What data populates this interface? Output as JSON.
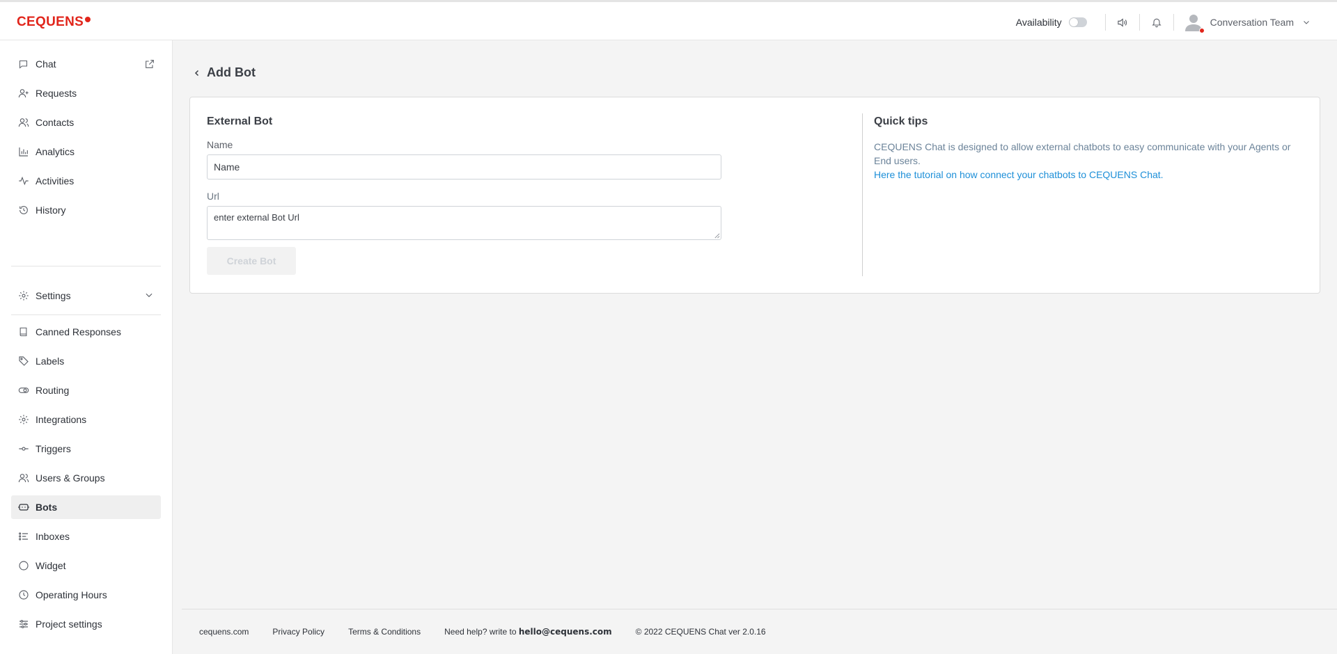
{
  "brand": {
    "logo_text": "CEQUENS",
    "accent": "#e1251b"
  },
  "topbar": {
    "availability_label": "Availability",
    "availability_on": false,
    "user_name": "Conversation Team"
  },
  "sidebar": {
    "top_items": [
      {
        "label": "Chat",
        "icon": "chat-icon"
      },
      {
        "label": "Requests",
        "icon": "add-user-icon"
      },
      {
        "label": "Contacts",
        "icon": "contacts-icon"
      },
      {
        "label": "Analytics",
        "icon": "bar-chart-icon"
      },
      {
        "label": "Activities",
        "icon": "activity-icon"
      },
      {
        "label": "History",
        "icon": "history-icon"
      }
    ],
    "settings_label": "Settings",
    "settings_items": [
      {
        "label": "Canned Responses",
        "icon": "book-icon"
      },
      {
        "label": "Labels",
        "icon": "tag-icon"
      },
      {
        "label": "Routing",
        "icon": "toggle-icon"
      },
      {
        "label": "Integrations",
        "icon": "gear-icon"
      },
      {
        "label": "Triggers",
        "icon": "commit-icon"
      },
      {
        "label": "Users & Groups",
        "icon": "users-icon"
      },
      {
        "label": "Bots",
        "icon": "bot-icon",
        "active": true
      },
      {
        "label": "Inboxes",
        "icon": "list-icon"
      },
      {
        "label": "Widget",
        "icon": "circle-icon"
      },
      {
        "label": "Operating Hours",
        "icon": "clock-icon"
      },
      {
        "label": "Project settings",
        "icon": "sliders-icon"
      }
    ]
  },
  "page": {
    "title": "Add Bot",
    "form": {
      "heading": "External Bot",
      "name_label": "Name",
      "name_placeholder": "Name",
      "url_label": "Url",
      "url_placeholder": "enter external Bot Url",
      "submit_label": "Create Bot"
    },
    "tips": {
      "heading": "Quick tips",
      "body": "CEQUENS Chat is designed to allow external chatbots to easy communicate with your Agents or End users.",
      "link": "Here the tutorial on how connect your chatbots to CEQUENS Chat."
    }
  },
  "footer": {
    "site": "cequens.com",
    "privacy": "Privacy Policy",
    "terms": "Terms & Conditions",
    "help_prefix": "Need help? write to",
    "help_email": "hello@cequens.com",
    "copyright": "© 2022 CEQUENS Chat ver 2.0.16"
  }
}
